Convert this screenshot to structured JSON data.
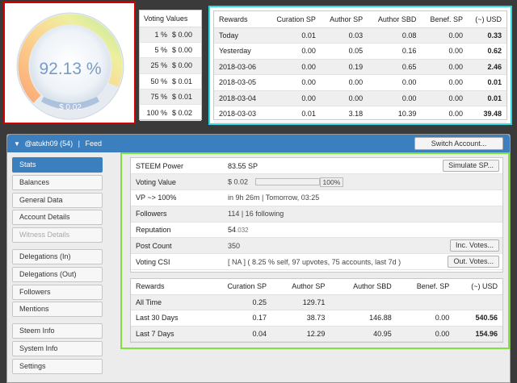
{
  "gauge": {
    "percent_text": "92.13 %",
    "percent": 92.13,
    "value_text": "$ 0.02"
  },
  "voting_values": {
    "title": "Voting Values",
    "rows": [
      {
        "pct": "1 %",
        "val": "$ 0.00"
      },
      {
        "pct": "5 %",
        "val": "$ 0.00"
      },
      {
        "pct": "25 %",
        "val": "$ 0.00"
      },
      {
        "pct": "50 %",
        "val": "$ 0.01"
      },
      {
        "pct": "75 %",
        "val": "$ 0.01"
      },
      {
        "pct": "100 %",
        "val": "$ 0.02"
      }
    ]
  },
  "top_rewards": {
    "headers": [
      "Rewards",
      "Curation SP",
      "Author SP",
      "Author SBD",
      "Benef. SP",
      "(~) USD"
    ],
    "rows": [
      [
        "Today",
        "0.01",
        "0.03",
        "0.08",
        "0.00",
        "0.33"
      ],
      [
        "Yesterday",
        "0.00",
        "0.05",
        "0.16",
        "0.00",
        "0.62"
      ],
      [
        "2018-03-06",
        "0.00",
        "0.19",
        "0.65",
        "0.00",
        "2.46"
      ],
      [
        "2018-03-05",
        "0.00",
        "0.00",
        "0.00",
        "0.00",
        "0.01"
      ],
      [
        "2018-03-04",
        "0.00",
        "0.00",
        "0.00",
        "0.00",
        "0.01"
      ],
      [
        "2018-03-03",
        "0.01",
        "3.18",
        "10.39",
        "0.00",
        "39.48"
      ]
    ]
  },
  "header": {
    "caret": "▼",
    "account": "@atukh09 (54)",
    "separator": "|",
    "feed": "Feed",
    "switch_label": "Switch Account..."
  },
  "sidebar": {
    "items": [
      {
        "label": "Stats",
        "state": "active"
      },
      {
        "label": "Balances",
        "state": "normal"
      },
      {
        "label": "General Data",
        "state": "normal"
      },
      {
        "label": "Account Details",
        "state": "normal"
      },
      {
        "label": "Witness Details",
        "state": "disabled"
      },
      {
        "label": "Delegations (In)",
        "state": "normal"
      },
      {
        "label": "Delegations (Out)",
        "state": "normal"
      },
      {
        "label": "Followers",
        "state": "normal"
      },
      {
        "label": "Mentions",
        "state": "normal"
      },
      {
        "label": "Steem Info",
        "state": "normal"
      },
      {
        "label": "System Info",
        "state": "normal"
      },
      {
        "label": "Settings",
        "state": "normal"
      }
    ]
  },
  "stats": {
    "steem_power": {
      "label": "STEEM Power",
      "value": "83.55 SP",
      "button": "Simulate SP..."
    },
    "voting_value": {
      "label": "Voting Value",
      "value": "$ 0.02",
      "bar_percent": 100,
      "bar_text": "100%"
    },
    "vp": {
      "label": "VP ~> 100%",
      "value": "in 9h 26m | Tomorrow, 03:25"
    },
    "followers": {
      "label": "Followers",
      "value": "114 | 16 following"
    },
    "reputation": {
      "label": "Reputation",
      "value_main": "54",
      "value_rest": ".032"
    },
    "post_count": {
      "label": "Post Count",
      "value": "350",
      "button": "Inc. Votes..."
    },
    "voting_csi": {
      "label": "Voting CSI",
      "value": "[ NA ] ( 8.25 % self, 97 upvotes, 75 accounts, last 7d )",
      "button": "Out. Votes..."
    }
  },
  "bottom_rewards": {
    "headers": [
      "Rewards",
      "Curation SP",
      "Author SP",
      "Author SBD",
      "Benef. SP",
      "(~) USD"
    ],
    "rows": [
      [
        "All Time",
        "0.25",
        "129.71",
        "",
        "",
        ""
      ],
      [
        "Last 30 Days",
        "0.17",
        "38.73",
        "146.88",
        "0.00",
        "540.56"
      ],
      [
        "Last 7 Days",
        "0.04",
        "12.29",
        "40.95",
        "0.00",
        "154.96"
      ]
    ]
  }
}
